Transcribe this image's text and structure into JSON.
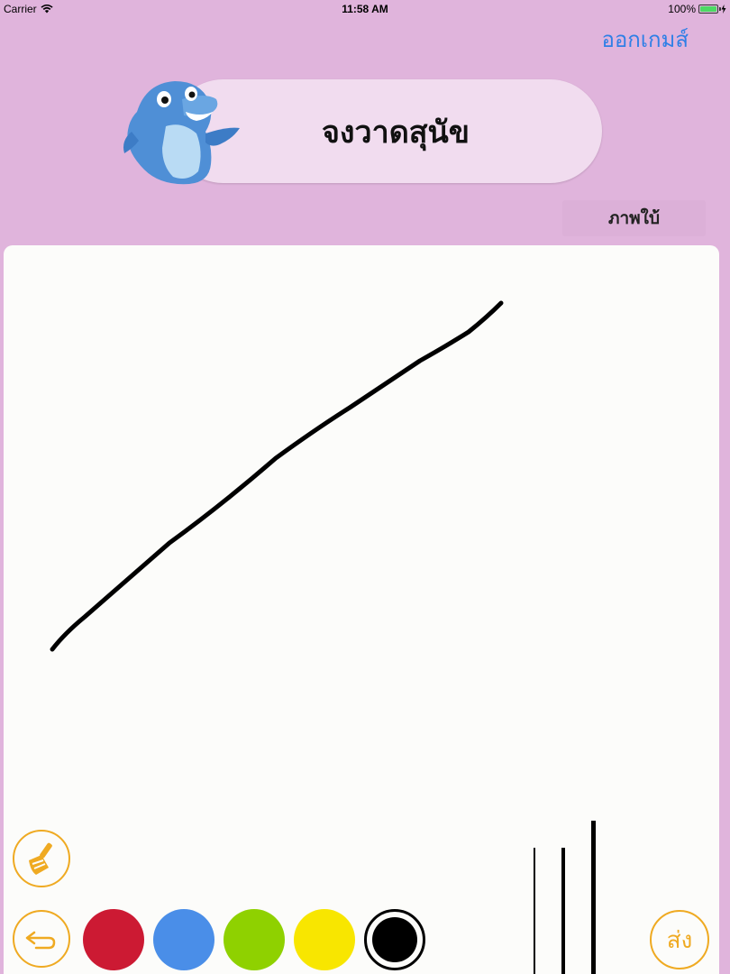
{
  "status_bar": {
    "carrier": "Carrier",
    "time": "11:58 AM",
    "battery": "100%"
  },
  "header": {
    "exit_label": "ออกเกมส์",
    "title": "จงวาดสุนัข",
    "hint_label": "ภาพใบ้"
  },
  "toolbar": {
    "eraser_icon": "broom-icon",
    "undo_icon": "undo-arrow-icon",
    "colors": [
      {
        "name": "red",
        "hex": "#cc1a33"
      },
      {
        "name": "blue",
        "hex": "#4a8ee8"
      },
      {
        "name": "green",
        "hex": "#8fd100"
      },
      {
        "name": "yellow",
        "hex": "#f8e600"
      },
      {
        "name": "black",
        "hex": "#000000",
        "selected": true
      }
    ],
    "brush_sizes": [
      "thin",
      "medium",
      "thick"
    ],
    "send_label": "ส่ง"
  },
  "theme": {
    "background": "#e0b4dc",
    "accent": "#efaa22",
    "link": "#2f7fe6"
  }
}
